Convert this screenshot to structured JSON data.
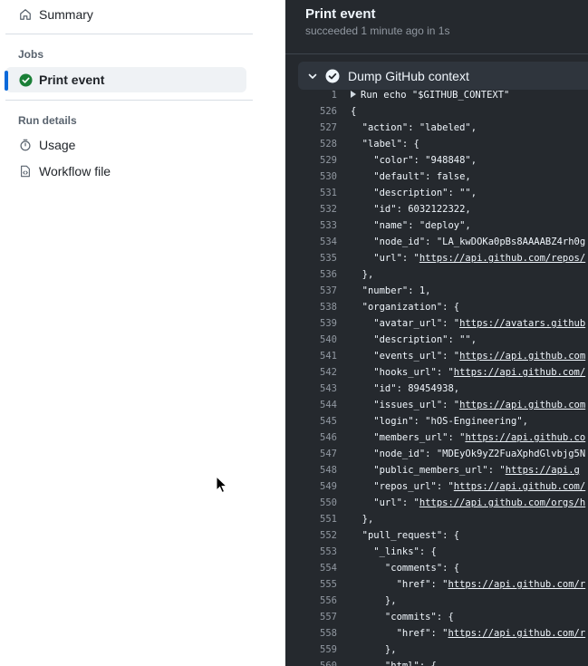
{
  "sidebar": {
    "summary_label": "Summary",
    "jobs_heading": "Jobs",
    "active_job_label": "Print event",
    "run_details_heading": "Run details",
    "usage_label": "Usage",
    "workflow_file_label": "Workflow file"
  },
  "log": {
    "job_title": "Print event",
    "job_status": "succeeded 1 minute ago in 1s",
    "step_name": "Dump GitHub context",
    "lines": [
      {
        "n": "1",
        "pre": "Run echo \"$GITHUB_CONTEXT\"",
        "link": "",
        "post": "",
        "run": true
      },
      {
        "n": "526",
        "pre": "{",
        "link": "",
        "post": ""
      },
      {
        "n": "527",
        "pre": "  \"action\": \"labeled\",",
        "link": "",
        "post": ""
      },
      {
        "n": "528",
        "pre": "  \"label\": {",
        "link": "",
        "post": ""
      },
      {
        "n": "529",
        "pre": "    \"color\": \"948848\",",
        "link": "",
        "post": ""
      },
      {
        "n": "530",
        "pre": "    \"default\": false,",
        "link": "",
        "post": ""
      },
      {
        "n": "531",
        "pre": "    \"description\": \"\",",
        "link": "",
        "post": ""
      },
      {
        "n": "532",
        "pre": "    \"id\": 6032122322,",
        "link": "",
        "post": ""
      },
      {
        "n": "533",
        "pre": "    \"name\": \"deploy\",",
        "link": "",
        "post": ""
      },
      {
        "n": "534",
        "pre": "    \"node_id\": \"LA_kwDOKa0pBs8AAAABZ4rh0g",
        "link": "",
        "post": ""
      },
      {
        "n": "535",
        "pre": "    \"url\": \"",
        "link": "https://api.github.com/repos/",
        "post": ""
      },
      {
        "n": "536",
        "pre": "  },",
        "link": "",
        "post": ""
      },
      {
        "n": "537",
        "pre": "  \"number\": 1,",
        "link": "",
        "post": ""
      },
      {
        "n": "538",
        "pre": "  \"organization\": {",
        "link": "",
        "post": ""
      },
      {
        "n": "539",
        "pre": "    \"avatar_url\": \"",
        "link": "https://avatars.github",
        "post": ""
      },
      {
        "n": "540",
        "pre": "    \"description\": \"\",",
        "link": "",
        "post": ""
      },
      {
        "n": "541",
        "pre": "    \"events_url\": \"",
        "link": "https://api.github.com",
        "post": ""
      },
      {
        "n": "542",
        "pre": "    \"hooks_url\": \"",
        "link": "https://api.github.com/",
        "post": ""
      },
      {
        "n": "543",
        "pre": "    \"id\": 89454938,",
        "link": "",
        "post": ""
      },
      {
        "n": "544",
        "pre": "    \"issues_url\": \"",
        "link": "https://api.github.com",
        "post": ""
      },
      {
        "n": "545",
        "pre": "    \"login\": \"hOS-Engineering\",",
        "link": "",
        "post": ""
      },
      {
        "n": "546",
        "pre": "    \"members_url\": \"",
        "link": "https://api.github.co",
        "post": ""
      },
      {
        "n": "547",
        "pre": "    \"node_id\": \"MDEyOk9yZ2FuaXphdGlvbjg5N",
        "link": "",
        "post": ""
      },
      {
        "n": "548",
        "pre": "    \"public_members_url\": \"",
        "link": "https://api.g",
        "post": ""
      },
      {
        "n": "549",
        "pre": "    \"repos_url\": \"",
        "link": "https://api.github.com/",
        "post": ""
      },
      {
        "n": "550",
        "pre": "    \"url\": \"",
        "link": "https://api.github.com/orgs/h",
        "post": ""
      },
      {
        "n": "551",
        "pre": "  },",
        "link": "",
        "post": ""
      },
      {
        "n": "552",
        "pre": "  \"pull_request\": {",
        "link": "",
        "post": ""
      },
      {
        "n": "553",
        "pre": "    \"_links\": {",
        "link": "",
        "post": ""
      },
      {
        "n": "554",
        "pre": "      \"comments\": {",
        "link": "",
        "post": ""
      },
      {
        "n": "555",
        "pre": "        \"href\": \"",
        "link": "https://api.github.com/r",
        "post": ""
      },
      {
        "n": "556",
        "pre": "      },",
        "link": "",
        "post": ""
      },
      {
        "n": "557",
        "pre": "      \"commits\": {",
        "link": "",
        "post": ""
      },
      {
        "n": "558",
        "pre": "        \"href\": \"",
        "link": "https://api.github.com/r",
        "post": ""
      },
      {
        "n": "559",
        "pre": "      },",
        "link": "",
        "post": ""
      },
      {
        "n": "560",
        "pre": "      \"html\": {",
        "link": "",
        "post": ""
      }
    ]
  },
  "colors": {
    "accent": "#0969da",
    "success": "#1a7f37",
    "log_bg": "#25292e"
  }
}
